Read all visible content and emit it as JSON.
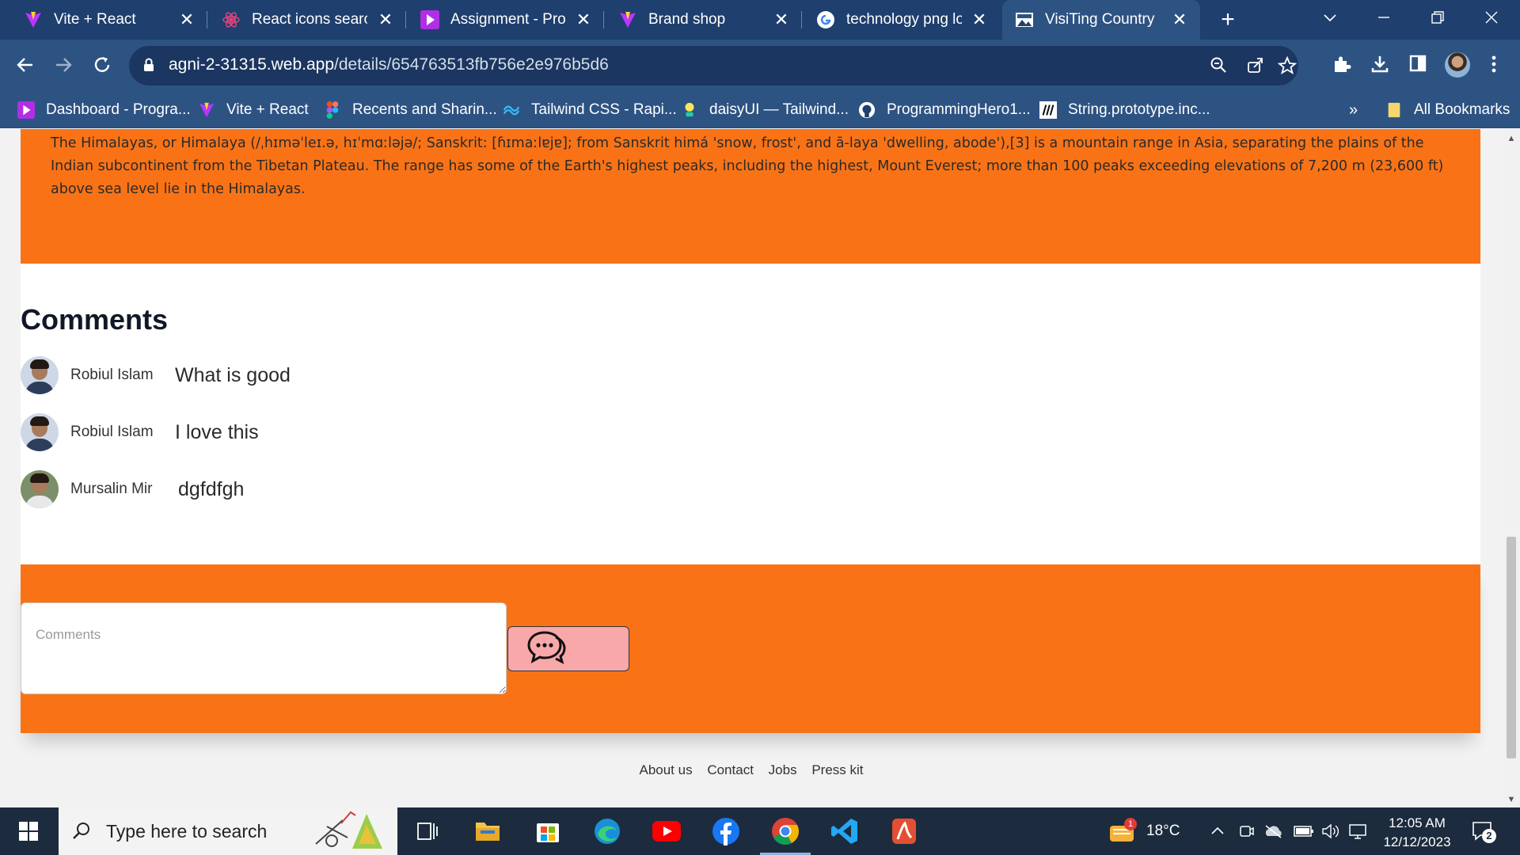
{
  "browser": {
    "tabs": [
      {
        "title": "Vite + React",
        "icon": "vite-icon",
        "active": false
      },
      {
        "title": "React icons search",
        "icon": "react-icon",
        "active": false
      },
      {
        "title": "Assignment - Prog",
        "icon": "programming-hero-icon",
        "active": false
      },
      {
        "title": "Brand shop",
        "icon": "vite-icon",
        "active": false
      },
      {
        "title": "technology png lo",
        "icon": "google-icon",
        "active": false
      },
      {
        "title": "VisiTing Country",
        "icon": "site-logo-icon",
        "active": true
      }
    ],
    "close_glyph": "✕",
    "new_tab_glyph": "+",
    "address": {
      "host": "agni-2-31315.web.app",
      "path": "/details/654763513fb756e2e976b5d6"
    },
    "bookmarks": [
      {
        "label": "Dashboard - Progra...",
        "icon": "programming-hero-icon"
      },
      {
        "label": "Vite + React",
        "icon": "vite-icon"
      },
      {
        "label": "Recents and Sharin...",
        "icon": "figma-icon"
      },
      {
        "label": "Tailwind CSS - Rapi...",
        "icon": "tailwind-icon"
      },
      {
        "label": "daisyUI — Tailwind...",
        "icon": "daisyui-icon"
      },
      {
        "label": "ProgrammingHero1...",
        "icon": "github-icon"
      },
      {
        "label": "String.prototype.inc...",
        "icon": "mdn-icon"
      }
    ],
    "bookmarks_overflow": "»",
    "all_bookmarks": "All Bookmarks"
  },
  "page": {
    "description": "The Himalayas, or Himalaya (/ˌhɪməˈleɪ.ə, hɪˈmɑːləjə/; Sanskrit: [ɦɪmaːlɐjɐ]; from Sanskrit himá 'snow, frost', and ā-laya 'dwelling, abode'),[3] is a mountain range in Asia, separating the plains of the Indian subcontinent from the Tibetan Plateau. The range has some of the Earth's highest peaks, including the highest, Mount Everest; more than 100 peaks exceeding elevations of 7,200 m (23,600 ft) above sea level lie in the Himalayas.",
    "comments_title": "Comments",
    "comments": [
      {
        "name": "Robiul Islam",
        "text": "What is good"
      },
      {
        "name": "Robiul Islam",
        "text": "I love this"
      },
      {
        "name": "Mursalin Mir",
        "text": "dgfdfgh"
      }
    ],
    "comment_placeholder": "Comments",
    "send_icon": "chat-bubble-icon",
    "footer_links": [
      "About us",
      "Contact",
      "Jobs",
      "Press kit"
    ],
    "accent_color": "#f97316",
    "button_color": "#f9a8aa"
  },
  "taskbar": {
    "search_placeholder": "Type here to search",
    "weather": "18°C",
    "weather_badge": "1",
    "time": "12:05 AM",
    "date": "12/12/2023",
    "notification_count": "2"
  }
}
